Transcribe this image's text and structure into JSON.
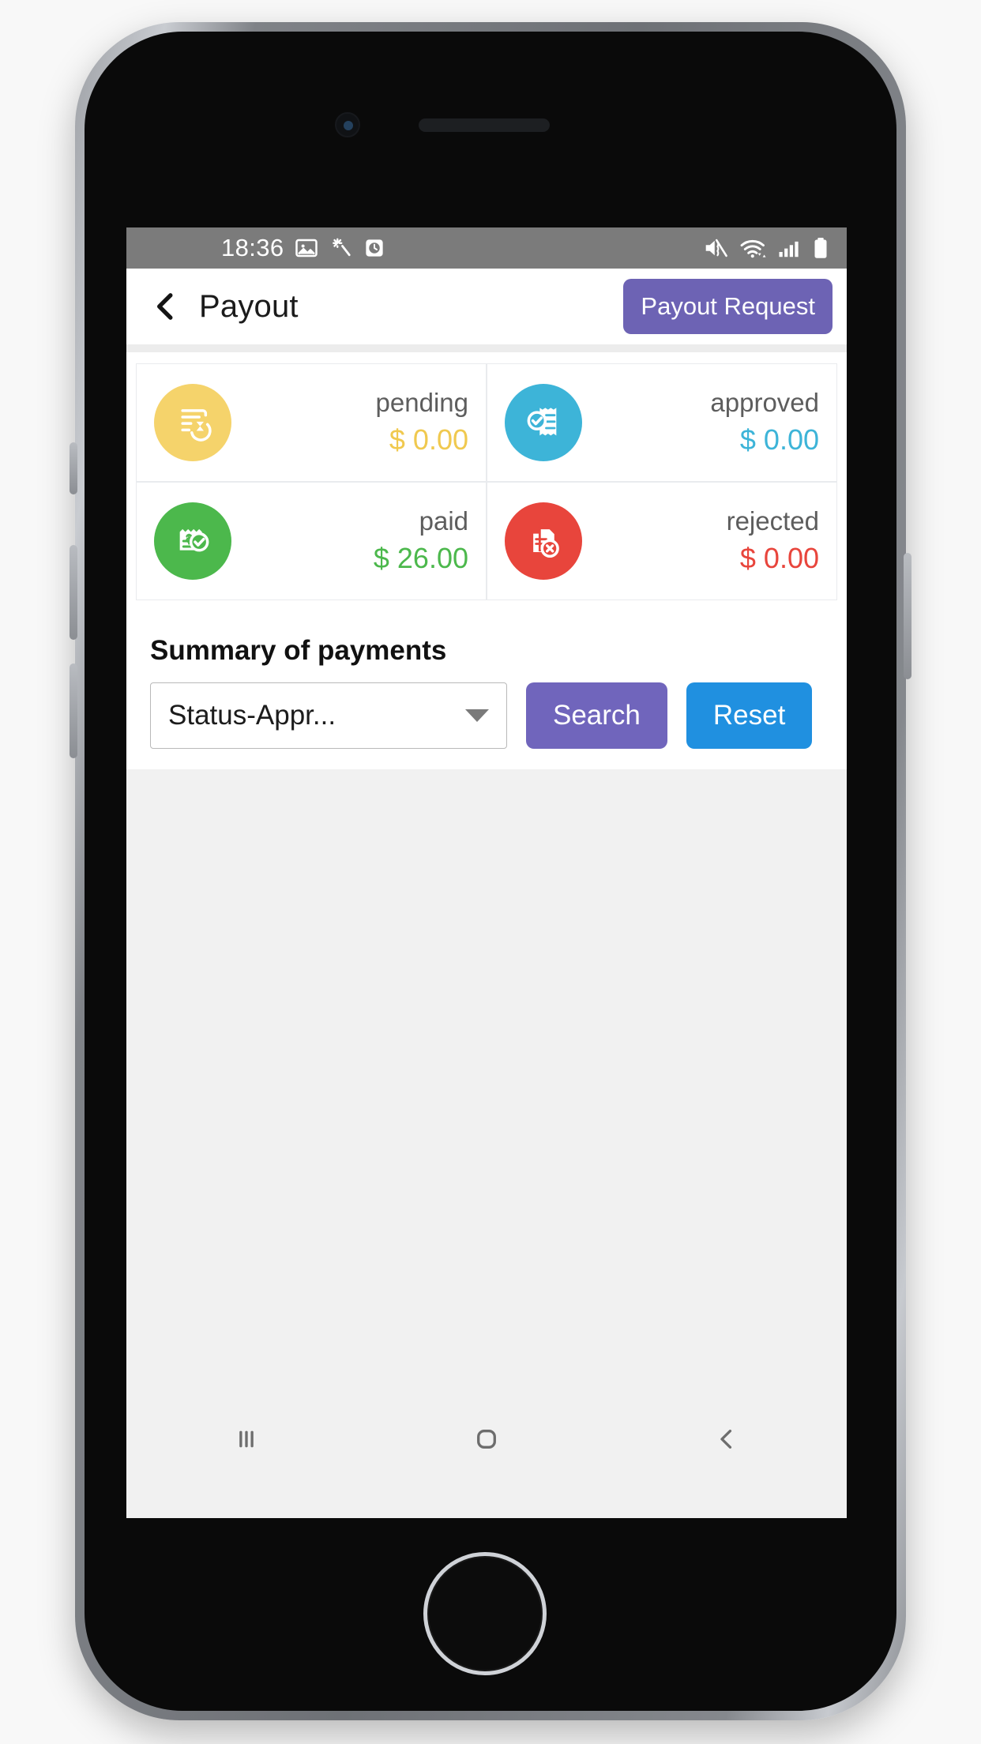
{
  "status_bar": {
    "time": "18:36",
    "left_icons": [
      "image-icon",
      "magic-wand-icon",
      "clock-icon"
    ],
    "right_icons": [
      "mute-vibrate-icon",
      "wifi-icon",
      "cellular-signal-icon",
      "battery-icon"
    ]
  },
  "app_bar": {
    "back_icon": "back-chevron-icon",
    "title": "Payout",
    "action_label": "Payout Request",
    "action_color": "#6d63b4"
  },
  "stats": [
    {
      "label": "pending",
      "amount": "$ 0.00",
      "color": "#f5d36b",
      "icon": "invoice-pending-icon"
    },
    {
      "label": "approved",
      "amount": "$ 0.00",
      "color": "#3db4d8",
      "icon": "invoice-approved-icon"
    },
    {
      "label": "paid",
      "amount": "$ 26.00",
      "color": "#4cb84c",
      "icon": "invoice-paid-icon"
    },
    {
      "label": "rejected",
      "amount": "$ 0.00",
      "color": "#e8453c",
      "icon": "invoice-rejected-icon"
    }
  ],
  "summary": {
    "title": "Summary of payments",
    "status_filter": {
      "value": "Status-Appr...",
      "caret_icon": "chevron-down-icon"
    },
    "search_label": "Search",
    "search_color": "#7065bc",
    "reset_label": "Reset",
    "reset_color": "#2090e0"
  },
  "nav_bar": {
    "recents_icon": "recents-icon",
    "home_icon": "home-icon",
    "back_icon": "nav-back-icon"
  }
}
